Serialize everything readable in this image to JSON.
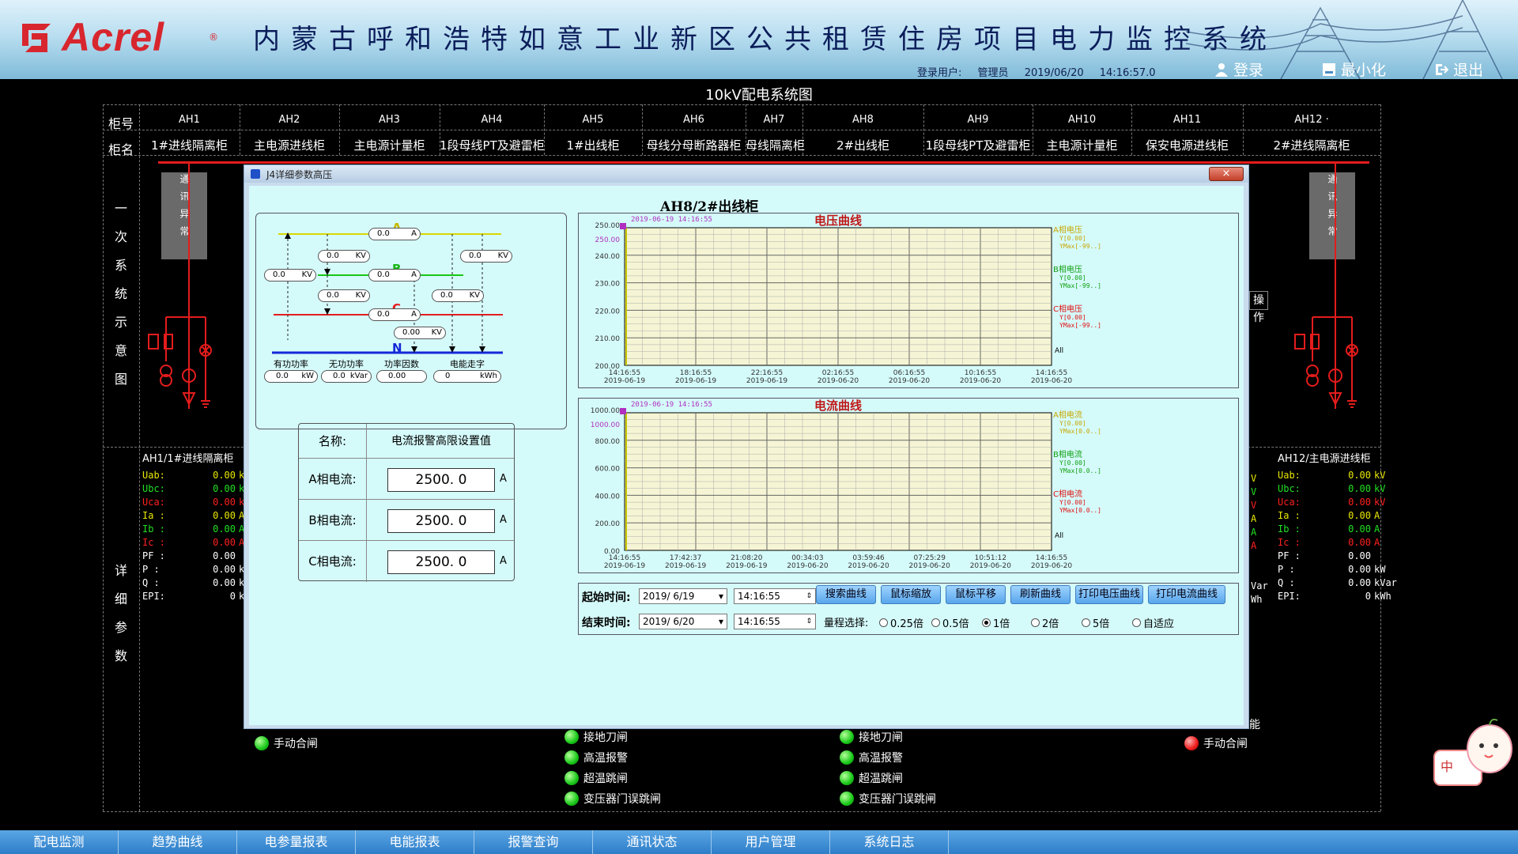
{
  "header": {
    "logo_text": "Acrel",
    "logo_reg": "®",
    "title": "内蒙古呼和浩特如意工业新区公共租赁住房项目电力监控系统",
    "login_label": "登录用户:",
    "login_user": "管理员",
    "date": "2019/06/20",
    "time": "14:16:57.0",
    "btn_login": "登录",
    "btn_minimize": "最小化",
    "btn_exit": "退出"
  },
  "diagram_title": "10kV配电系统图",
  "row_labels": {
    "no": "柜号",
    "name": "柜名"
  },
  "cabinets": [
    {
      "no": "AH1",
      "name": "1#进线隔离柜"
    },
    {
      "no": "AH2",
      "name": "主电源进线柜"
    },
    {
      "no": "AH3",
      "name": "主电源计量柜"
    },
    {
      "no": "AH4",
      "name": "1段母线PT及避雷柜"
    },
    {
      "no": "AH5",
      "name": "1#出线柜"
    },
    {
      "no": "AH6",
      "name": "母线分母断路器柜"
    },
    {
      "no": "AH7",
      "name": "母线隔离柜"
    },
    {
      "no": "AH8",
      "name": "2#出线柜"
    },
    {
      "no": "AH9",
      "name": "1段母线PT及避雷柜"
    },
    {
      "no": "AH10",
      "name": "主电源计量柜"
    },
    {
      "no": "AH11",
      "name": "保安电源进线柜"
    },
    {
      "no": "AH12 ·",
      "name": "2#进线隔离柜"
    }
  ],
  "side_titles": {
    "primary": "一次系统示意图",
    "detail": "详细参数"
  },
  "comm_status": "通讯异常",
  "left_params": {
    "header": "AH1/1#进线隔离柜",
    "rows": [
      {
        "k": "Uab:",
        "v": "0.00",
        "u": "kV",
        "color": "#e8e800"
      },
      {
        "k": "Ubc:",
        "v": "0.00",
        "u": "kV",
        "color": "#20e020"
      },
      {
        "k": "Uca:",
        "v": "0.00",
        "u": "kV",
        "color": "#ff2020"
      },
      {
        "k": "Ia :",
        "v": "0.00",
        "u": "A",
        "color": "#e8e800"
      },
      {
        "k": "Ib :",
        "v": "0.00",
        "u": "A",
        "color": "#20e020"
      },
      {
        "k": "Ic :",
        "v": "0.00",
        "u": "A",
        "color": "#ff2020"
      },
      {
        "k": "PF :",
        "v": "0.00",
        "u": "",
        "color": "#ffffff"
      },
      {
        "k": "P  :",
        "v": "0.00",
        "u": "kW",
        "color": "#ffffff"
      },
      {
        "k": "Q  :",
        "v": "0.00",
        "u": "kVar",
        "color": "#ffffff"
      },
      {
        "k": "EPI:",
        "v": "0",
        "u": "kWh",
        "color": "#ffffff"
      }
    ]
  },
  "right_params": {
    "header": "AH12/主电源进线柜",
    "rows": [
      {
        "k": "Uab:",
        "v": "0.00",
        "u": "kV",
        "color": "#e8e800"
      },
      {
        "k": "Ubc:",
        "v": "0.00",
        "u": "kV",
        "color": "#20e020"
      },
      {
        "k": "Uca:",
        "v": "0.00",
        "u": "kV",
        "color": "#ff2020"
      },
      {
        "k": "Ia :",
        "v": "0.00",
        "u": "A",
        "color": "#e8e800"
      },
      {
        "k": "Ib :",
        "v": "0.00",
        "u": "A",
        "color": "#20e020"
      },
      {
        "k": "Ic :",
        "v": "0.00",
        "u": "A",
        "color": "#ff2020"
      },
      {
        "k": "PF :",
        "v": "0.00",
        "u": "",
        "color": "#ffffff"
      },
      {
        "k": "P  :",
        "v": "0.00",
        "u": "kW",
        "color": "#ffffff"
      },
      {
        "k": "Q  :",
        "v": "0.00",
        "u": "kVar",
        "color": "#ffffff"
      },
      {
        "k": "EPI:",
        "v": "0",
        "u": "kWh",
        "color": "#ffffff"
      }
    ]
  },
  "peek_right": {
    "op": "操作",
    "func": "能",
    "partial": [
      "V",
      "V",
      "V",
      "A",
      "A",
      "A",
      "",
      "",
      "Var",
      "Wh"
    ]
  },
  "indicators": {
    "left_close": "手动合闸",
    "right_close": "手动合闸",
    "group": [
      "接地刀闸",
      "高温报警",
      "超温跳闸",
      "变压器门误跳闸"
    ]
  },
  "nav": [
    "配电监测",
    "趋势曲线",
    "电参量报表",
    "电能报表",
    "报警查询",
    "通讯状态",
    "用户管理",
    "系统日志"
  ],
  "popup": {
    "title": "J4详细参数高压",
    "close": "×",
    "cabinet_title": "AH8/2#出线柜",
    "phases": {
      "a": "A",
      "b": "B",
      "c": "C",
      "n": "N"
    },
    "phase_readings": {
      "a_current": "0.0",
      "b_current": "0.0",
      "c_current": "0.0",
      "uab": "0.0",
      "ubc": "0.0",
      "uca": "0.0",
      "left": "0.0",
      "right_top": "0.0",
      "right_mid": "0.0",
      "n_kv": "0.00",
      "cur_unit": "A",
      "kv_unit": "KV"
    },
    "summary": [
      {
        "label": "有功功率",
        "value": "0.0",
        "unit": "kW"
      },
      {
        "label": "无功功率",
        "value": "0.0",
        "unit": "kVar"
      },
      {
        "label": "功率因数",
        "value": "0.00",
        "unit": ""
      },
      {
        "label": "电能走字",
        "value": "0",
        "unit": "kWh"
      }
    ],
    "settings": {
      "name_label": "名称:",
      "name_value": "电流报警高限设置值",
      "rows": [
        {
          "label": "A相电流:",
          "value": "2500. 0",
          "unit": "A"
        },
        {
          "label": "B相电流:",
          "value": "2500. 0",
          "unit": "A"
        },
        {
          "label": "C相电流:",
          "value": "2500. 0",
          "unit": "A"
        }
      ]
    },
    "voltage_chart": {
      "title": "电压曲线",
      "cursor": "2019-06-19 14:16:55",
      "cursor_value": "250.00",
      "y_ticks": [
        "250.00",
        "240.00",
        "230.00",
        "220.00",
        "210.00",
        "200.00"
      ],
      "x_ticks": [
        [
          "14:16:55",
          "2019-06-19"
        ],
        [
          "18:16:55",
          "2019-06-19"
        ],
        [
          "22:16:55",
          "2019-06-19"
        ],
        [
          "02:16:55",
          "2019-06-20"
        ],
        [
          "06:16:55",
          "2019-06-20"
        ],
        [
          "10:16:55",
          "2019-06-20"
        ],
        [
          "14:16:55",
          "2019-06-20"
        ]
      ],
      "legend": [
        {
          "name": "A相电压",
          "y": "Y[0.00]",
          "ymax": "YMax[-99..]",
          "color": "#c8a800"
        },
        {
          "name": "B相电压",
          "y": "Y[0.00]",
          "ymax": "YMax[-99..]",
          "color": "#10a010"
        },
        {
          "name": "C相电压",
          "y": "Y[0.00]",
          "ymax": "YMax[-99..]",
          "color": "#e01010"
        }
      ],
      "all": "All"
    },
    "current_chart": {
      "title": "电流曲线",
      "cursor": "2019-06-19 14:16:55",
      "cursor_value": "1000.00",
      "y_ticks": [
        "1000.00",
        "800.00",
        "600.00",
        "400.00",
        "200.00",
        "0.00"
      ],
      "x_ticks": [
        [
          "14:16:55",
          "2019-06-19"
        ],
        [
          "17:42:37",
          "2019-06-19"
        ],
        [
          "21:08:20",
          "2019-06-19"
        ],
        [
          "00:34:03",
          "2019-06-20"
        ],
        [
          "03:59:46",
          "2019-06-20"
        ],
        [
          "07:25:29",
          "2019-06-20"
        ],
        [
          "10:51:12",
          "2019-06-20"
        ],
        [
          "14:16:55",
          "2019-06-20"
        ]
      ],
      "legend": [
        {
          "name": "A相电流",
          "y": "Y[0.00]",
          "ymax": "YMax[0.0..]",
          "color": "#c8a800"
        },
        {
          "name": "B相电流",
          "y": "Y[0.00]",
          "ymax": "YMax[0.0..]",
          "color": "#10a010"
        },
        {
          "name": "C相电流",
          "y": "Y[0.00]",
          "ymax": "YMax[0.0..]",
          "color": "#e01010"
        }
      ],
      "all": "All"
    },
    "controls": {
      "start_label": "起始时间:",
      "start_date": "2019/ 6/19",
      "start_time": "14:16:55",
      "end_label": "结束时间:",
      "end_date": "2019/ 6/20",
      "end_time": "14:16:55",
      "buttons": [
        "搜索曲线",
        "鼠标缩放",
        "鼠标平移",
        "刷新曲线",
        "打印电压曲线",
        "打印电流曲线"
      ],
      "range_label": "量程选择:",
      "ranges": [
        "0.25倍",
        "0.5倍",
        "1倍",
        "2倍",
        "5倍",
        "自适应"
      ],
      "selected_range": "1倍"
    }
  },
  "mascot_text": "中",
  "colors": {
    "bus_red": "#e41c1c",
    "nav_blue": "#3d8bd6",
    "popup_bg": "#d5fafa"
  }
}
